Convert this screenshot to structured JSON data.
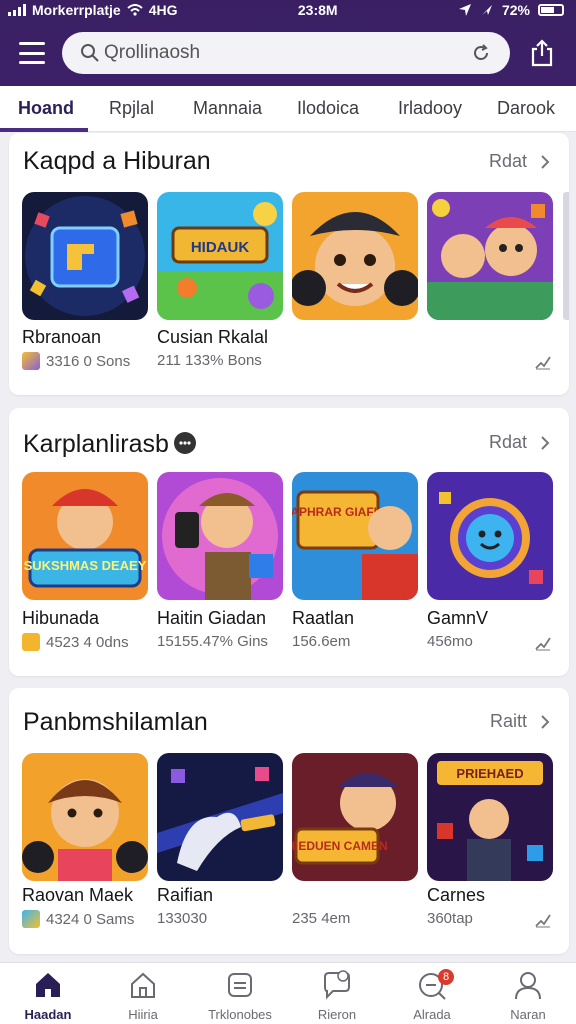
{
  "status_bar": {
    "carrier": "Morkerrplatje",
    "network": "4HG",
    "time": "23:8M",
    "battery": "72%"
  },
  "search": {
    "value": "Qrollinaosh"
  },
  "tabs": [
    {
      "label": "Hoand",
      "active": true
    },
    {
      "label": "Rpjlal"
    },
    {
      "label": "Mannaia"
    },
    {
      "label": "Ilodoica"
    },
    {
      "label": "Irladooy"
    },
    {
      "label": "Darook"
    }
  ],
  "sections": [
    {
      "title": "Kaqpd a Hiburan",
      "see_all": "Rdat",
      "apps": [
        {
          "name": "Rbranoan",
          "meta": "3316 0 Sons"
        },
        {
          "name": "Cusian Rkalal",
          "meta": "211 133% Bons"
        },
        {
          "name": "",
          "meta": ""
        },
        {
          "name": "",
          "meta": ""
        }
      ]
    },
    {
      "title": "Karplanlirasb",
      "see_all": "Rdat",
      "apps": [
        {
          "name": "Hibunada",
          "meta": "4523 4 0dns"
        },
        {
          "name": "Haitin Giadan",
          "meta": "15155.47% Gins"
        },
        {
          "name": "Raatlan",
          "meta": "156.6em"
        },
        {
          "name": "GamnV",
          "meta": "456mo"
        }
      ]
    },
    {
      "title": "Panbmshilamlan",
      "see_all": "Raitt",
      "apps": [
        {
          "name": "Raovan Maek",
          "meta": "4324 0 Sams"
        },
        {
          "name": "Raifian",
          "meta": "133030"
        },
        {
          "name": "",
          "meta": "235 4em"
        },
        {
          "name": "Carnes",
          "meta": "360tap"
        }
      ]
    }
  ],
  "tile_art": {
    "r0c1": "HIDAUK",
    "r1c0": "SUKSHMAS DEAEY",
    "r1c2": "RAPHRAR GIAFIAU",
    "r2c2": "HIEDUEN CAMEN",
    "r2c3": "PRIEHAED"
  },
  "bottom_nav": [
    {
      "label": "Haadan",
      "icon": "home-icon",
      "active": true
    },
    {
      "label": "Hiiria",
      "icon": "house-outline-icon"
    },
    {
      "label": "Trklonobes",
      "icon": "apps-icon"
    },
    {
      "label": "Rieron",
      "icon": "chat-icon"
    },
    {
      "label": "Alrada",
      "icon": "notification-icon",
      "badge": "8"
    },
    {
      "label": "Naran",
      "icon": "profile-icon"
    }
  ],
  "colors": {
    "header": "#3a1f63",
    "accent": "#4a2d82",
    "badge": "#d93a2b"
  }
}
